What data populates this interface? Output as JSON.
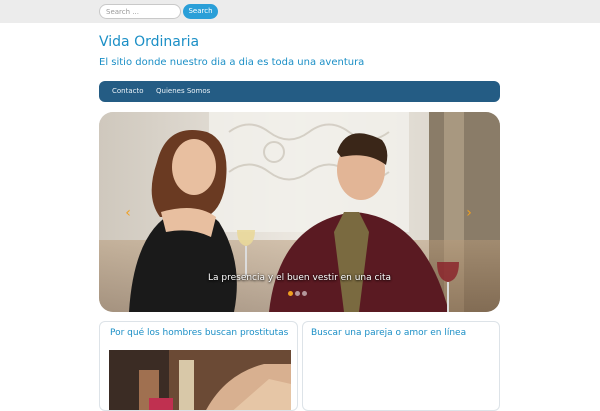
{
  "topbar": {
    "search_placeholder": "Search ...",
    "search_button_label": "Search"
  },
  "site": {
    "title": "Vida Ordinaria",
    "tagline": "El sitio donde nuestro dia a dia es toda una aventura"
  },
  "nav": {
    "items": [
      {
        "label": "Contacto"
      },
      {
        "label": "Quienes Somos"
      }
    ]
  },
  "slider": {
    "caption": "La presencia y el buen vestir en una cita",
    "prev_arrow_icon": "chevron-left-icon",
    "next_arrow_icon": "chevron-right-icon",
    "arrow_color": "#f0a020",
    "slide_count": 3,
    "active_slide": 1
  },
  "posts": [
    {
      "title": "Por qué los hombres buscan prostitutas"
    },
    {
      "title": "Buscar una pareja o amor en línea"
    }
  ],
  "colors": {
    "accent": "#1b8fc6",
    "nav_background": "#245c84",
    "search_button": "#2a9fd8"
  }
}
